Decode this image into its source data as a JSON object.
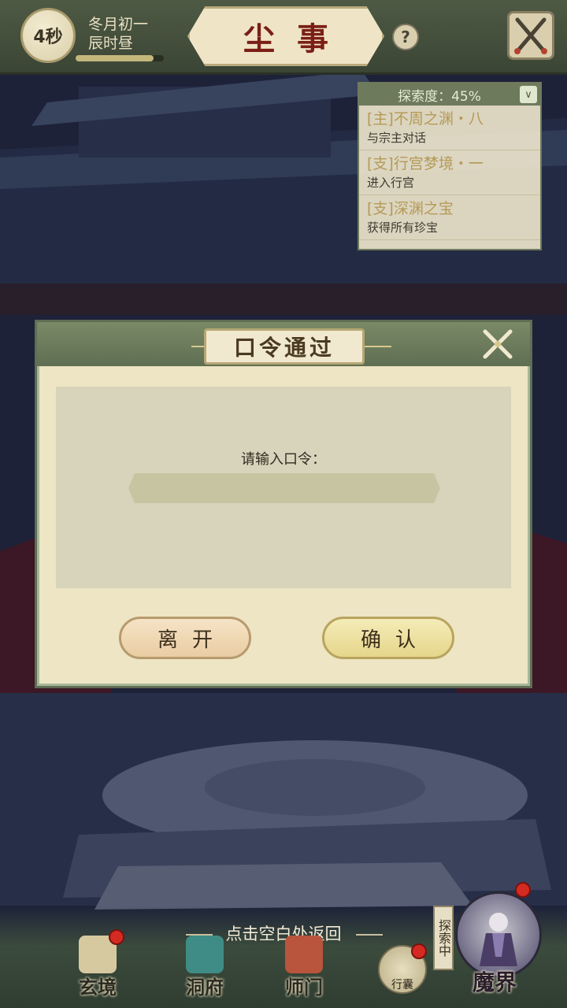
{
  "header": {
    "timer": "4秒",
    "date_line1": "冬月初一",
    "date_line2": "辰时昼",
    "title": "尘事",
    "help": "?",
    "time_progress": 0.88
  },
  "quest_panel": {
    "progress_label": "探索度：45%",
    "toggle": "∨",
    "quests": [
      {
        "title": "[主]不周之渊・八",
        "desc": "与宗主对话"
      },
      {
        "title": "[支]行宫梦境・一",
        "desc": "进入行宫"
      },
      {
        "title": "[支]深渊之宝",
        "desc": "获得所有珍宝"
      }
    ]
  },
  "dialog": {
    "title": "口令通过",
    "prompt": "请输入口令：",
    "input_value": "",
    "leave_button": "离开",
    "confirm_button": "确认"
  },
  "return_hint": "点击空白处返回",
  "bottom_nav": {
    "items": [
      {
        "label": "玄境"
      },
      {
        "label": "洞府"
      },
      {
        "label": "师门"
      }
    ],
    "bag_label": "行囊",
    "explore_tag": "探索中",
    "realm_label": "魔界"
  },
  "colors": {
    "header_bg": "#4e5a44",
    "title_red": "#7b1f16",
    "dialog_bg": "#ede5c3",
    "dialog_head": "#6e7d5c",
    "badge_red": "#d52a22"
  }
}
